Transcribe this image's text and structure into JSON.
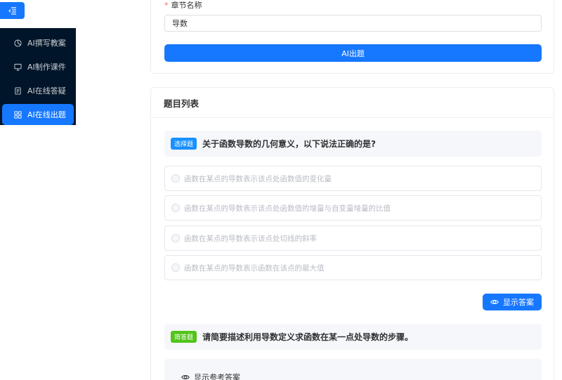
{
  "sidebar": {
    "items": [
      {
        "label": "AI撰写教案",
        "icon": "pie-chart-icon",
        "active": false
      },
      {
        "label": "AI制作课件",
        "icon": "monitor-icon",
        "active": false
      },
      {
        "label": "AI在线答疑",
        "icon": "document-icon",
        "active": false
      },
      {
        "label": "AI在线出题",
        "icon": "grid-icon",
        "active": true
      }
    ]
  },
  "form": {
    "label": "章节名称",
    "required_mark": "*",
    "chapter_value": "导数",
    "submit_label": "AI出题"
  },
  "question_list": {
    "title": "题目列表",
    "questions": [
      {
        "type_tag": "选择题",
        "text": "关于函数导数的几何意义，以下说法正确的是?",
        "options": [
          "函数在某点的导数表示该点处函数值的变化量",
          "函数在某点的导数表示该点处函数值的增量与自变量增量的比值",
          "函数在某点的导数表示该点处切线的斜率",
          "函数在某点的导数表示函数在该点的最大值"
        ],
        "show_answer_label": "显示答案"
      },
      {
        "type_tag": "简答题",
        "text": "请简要描述利用导数定义求函数在某一点处导数的步骤。",
        "show_reference_label": "显示参考答案"
      }
    ]
  },
  "colors": {
    "primary": "#1677ff",
    "sidebar_bg": "#001529",
    "tag_choice": "#1890ff",
    "tag_short": "#52c41a"
  }
}
